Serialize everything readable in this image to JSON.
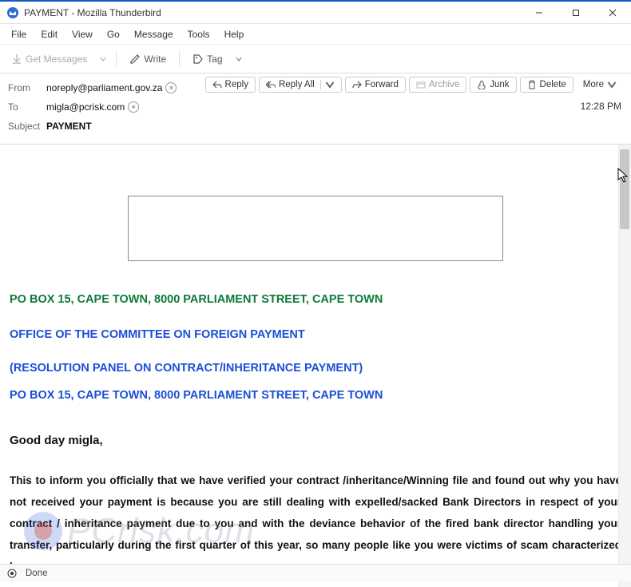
{
  "window": {
    "title": "PAYMENT - Mozilla Thunderbird"
  },
  "menu": {
    "file": "File",
    "edit": "Edit",
    "view": "View",
    "go": "Go",
    "message": "Message",
    "tools": "Tools",
    "help": "Help"
  },
  "toolbar": {
    "get_messages": "Get Messages",
    "write": "Write",
    "tag": "Tag"
  },
  "headers": {
    "from_label": "From",
    "from_value": "noreply@parliament.gov.za",
    "to_label": "To",
    "to_value": "migla@pcrisk.com",
    "subject_label": "Subject",
    "subject_value": "PAYMENT",
    "timestamp": "12:28 PM"
  },
  "actions": {
    "reply": "Reply",
    "reply_all": "Reply All",
    "forward": "Forward",
    "archive": "Archive",
    "junk": "Junk",
    "delete": "Delete",
    "more": "More"
  },
  "email": {
    "line1": "PO BOX 15, CAPE TOWN, 8000 PARLIAMENT STREET, CAPE TOWN",
    "line2": "OFFICE OF THE COMMITTEE ON FOREIGN PAYMENT",
    "line3": "(RESOLUTION PANEL ON CONTRACT/INHERITANCE PAYMENT)",
    "line4": "PO BOX 15, CAPE TOWN, 8000 PARLIAMENT STREET, CAPE TOWN",
    "greeting": "Good day migla,",
    "body1": "This to inform you officially that we have verified your contract /inheritance/Winning file and found out why you have not received your payment is because you are still dealing with expelled/sacked Bank Directors in respect of your contract / inheritance payment due to you and with the deviance behavior of the fired bank director handling your transfer, particularly during the first quarter of this year, so many people like you were victims of scam characterized by"
  },
  "status": {
    "done": "Done"
  },
  "watermark": {
    "text": "PCrisk.com"
  }
}
